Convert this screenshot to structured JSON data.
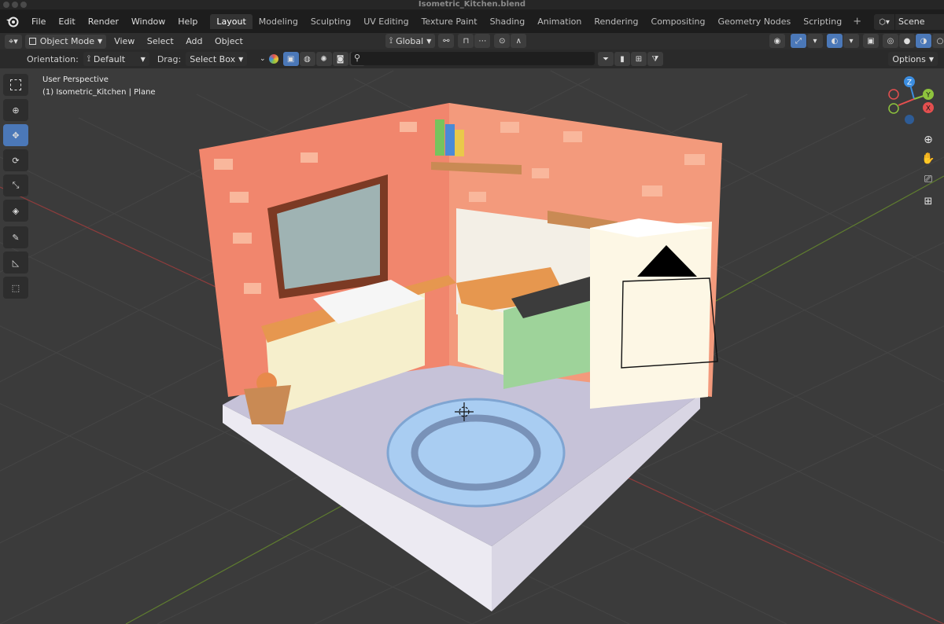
{
  "window_title": "Isometric_Kitchen.blend",
  "menu": [
    "File",
    "Edit",
    "Render",
    "Window",
    "Help"
  ],
  "workspaces": [
    {
      "label": "Layout",
      "active": true
    },
    {
      "label": "Modeling",
      "active": false
    },
    {
      "label": "Sculpting",
      "active": false
    },
    {
      "label": "UV Editing",
      "active": false
    },
    {
      "label": "Texture Paint",
      "active": false
    },
    {
      "label": "Shading",
      "active": false
    },
    {
      "label": "Animation",
      "active": false
    },
    {
      "label": "Rendering",
      "active": false
    },
    {
      "label": "Compositing",
      "active": false
    },
    {
      "label": "Geometry Nodes",
      "active": false
    },
    {
      "label": "Scripting",
      "active": false
    }
  ],
  "add_workspace_label": "+",
  "scene_name": "Scene",
  "header": {
    "mode": "Object Mode",
    "menus": [
      "View",
      "Select",
      "Add",
      "Object"
    ],
    "transform_orientation": "Global"
  },
  "toolsettings": {
    "orientation_label": "Orientation:",
    "orientation_value": "Default",
    "drag_label": "Drag:",
    "drag_value": "Select Box",
    "search_placeholder": "",
    "options_label": "Options"
  },
  "viewport": {
    "perspective": "User Perspective",
    "object_info": "(1) Isometric_Kitchen | Plane",
    "axes": {
      "z": "Z",
      "y": "Y",
      "x": "X"
    }
  },
  "colors": {
    "accent": "#4b78b8",
    "axis_x": "#e44f4f",
    "axis_y": "#8ec33d",
    "axis_z": "#3b8de0"
  }
}
